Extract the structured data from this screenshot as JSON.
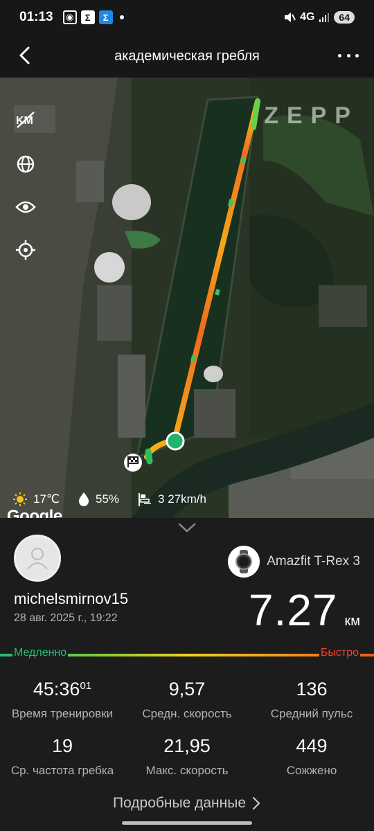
{
  "status": {
    "time": "01:13",
    "network": "4G",
    "battery": "64"
  },
  "header": {
    "title": "академическая гребля"
  },
  "map": {
    "watermark": "ZEPP",
    "attribution": "Google",
    "weather": {
      "temperature": "17℃",
      "humidity": "55%",
      "wind": "3 27km/h"
    }
  },
  "workout": {
    "username": "michelsmirnov15",
    "datetime": "28 авг. 2025 г., 19:22",
    "device": "Amazfit T-Rex 3",
    "distance": "7.27",
    "distance_unit": "км",
    "speed_legend": {
      "slow": "Медленно",
      "fast": "Быстро"
    },
    "stats": [
      {
        "value": "45:36",
        "sup": "01",
        "label": "Время тренировки"
      },
      {
        "value": "9,57",
        "sup": "",
        "label": "Средн. скорость"
      },
      {
        "value": "136",
        "sup": "",
        "label": "Средний пульс"
      },
      {
        "value": "19",
        "sup": "",
        "label": "Ср. частота гребка"
      },
      {
        "value": "21,95",
        "sup": "",
        "label": "Макс. скорость"
      },
      {
        "value": "449",
        "sup": "",
        "label": "Сожжено"
      }
    ],
    "details_label": "Подробные данные"
  },
  "colors": {
    "slow": "#21c17a",
    "fast": "#f0432a",
    "route_start": "#1fb46a"
  }
}
